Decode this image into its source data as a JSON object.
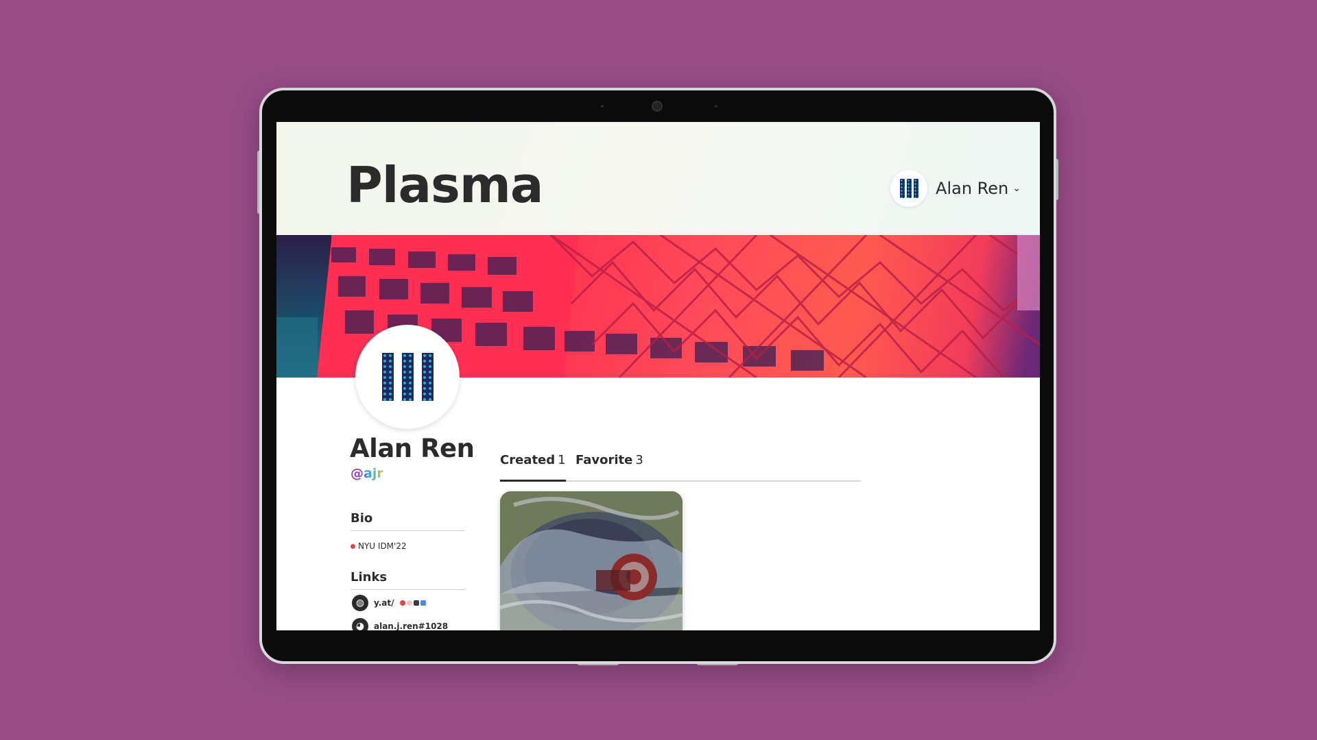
{
  "app": {
    "name": "Plasma"
  },
  "user_menu": {
    "name": "Alan Ren"
  },
  "profile": {
    "name": "Alan Ren",
    "handle": "@ajr",
    "bio_label": "Bio",
    "bio_text": "NYU IDM'22",
    "links_label": "Links",
    "links": [
      {
        "text": "y.at/",
        "icon": "globe-icon"
      },
      {
        "text": "alan.j.ren#1028",
        "icon": "discord-icon"
      }
    ]
  },
  "tabs": [
    {
      "label": "Created",
      "count": "1",
      "active": true
    },
    {
      "label": "Favorite",
      "count": "3",
      "active": false
    }
  ],
  "colors": {
    "background": "#974c86",
    "text": "#2b2b2b",
    "banner_accent": "#ff2d4e"
  }
}
